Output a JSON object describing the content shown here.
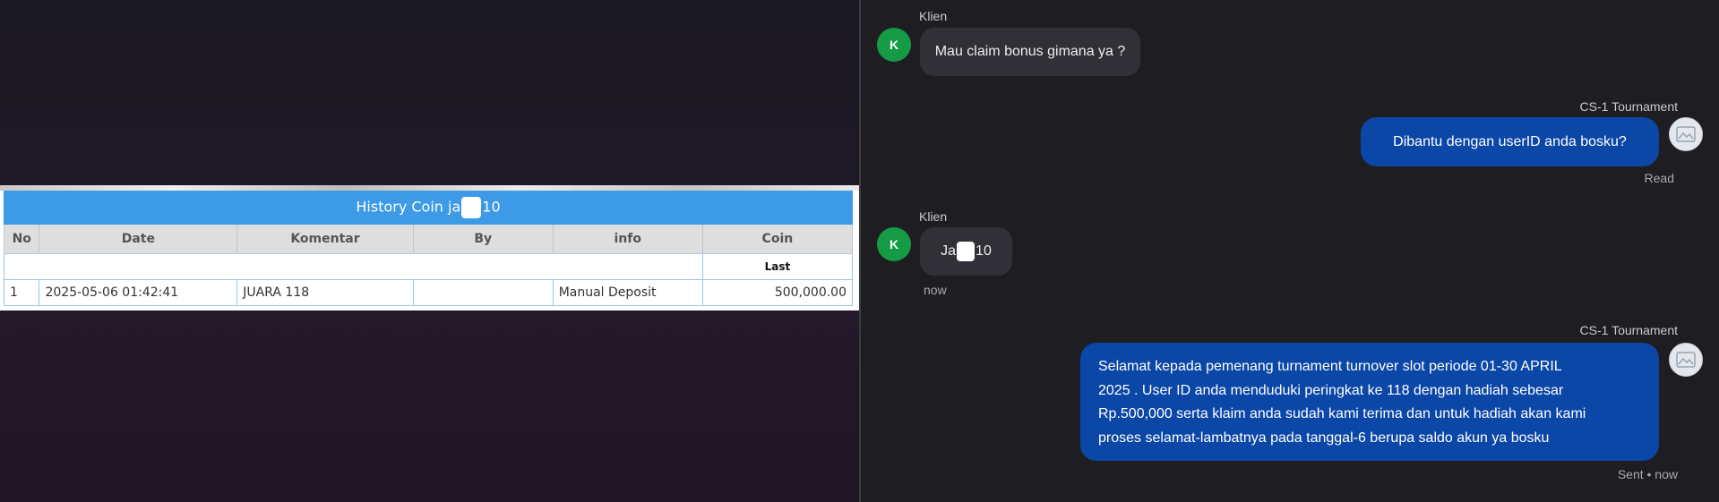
{
  "history": {
    "title_prefix": "History Coin ja",
    "title_suffix": "10",
    "columns": [
      "No",
      "Date",
      "Komentar",
      "By",
      "info",
      "Coin"
    ],
    "last_label": "Last",
    "rows": [
      {
        "no": "1",
        "date": "2025-05-06 01:42:41",
        "komentar": "JUARA 118",
        "by": "",
        "info": "Manual Deposit",
        "coin": "500,000.00"
      }
    ]
  },
  "chat": {
    "messages": [
      {
        "sender": "Klien",
        "avatar": "K",
        "text": "Mau claim bonus gimana ya ?"
      },
      {
        "sender": "CS-1 Tournament",
        "text": "Dibantu dengan userID anda bosku?",
        "status": "Read"
      },
      {
        "sender": "Klien",
        "avatar": "K",
        "text_prefix": "Ja",
        "text_suffix": "10",
        "time": "now"
      },
      {
        "sender": "CS-1 Tournament",
        "lines": [
          "Selamat kepada pemenang turnament turnover slot periode 01-30 APRIL",
          "2025 . User ID anda menduduki peringkat ke 118 dengan hadiah sebesar",
          "Rp.500,000 serta klaim anda sudah kami terima dan untuk hadiah akan kami",
          "proses selamat-lambatnya pada tanggal-6 berupa saldo akun ya bosku"
        ],
        "status": "Sent • now"
      }
    ]
  },
  "colors": {
    "table_header_blue": "#3d9ae6",
    "out_bubble": "#0b47a6",
    "in_bubble": "#303036",
    "avatar_green": "#159a45",
    "coin_green": "#2e8b2e"
  },
  "icons": {
    "agent_avatar": "mountain-photo-icon",
    "redaction": "white-redaction-block"
  }
}
